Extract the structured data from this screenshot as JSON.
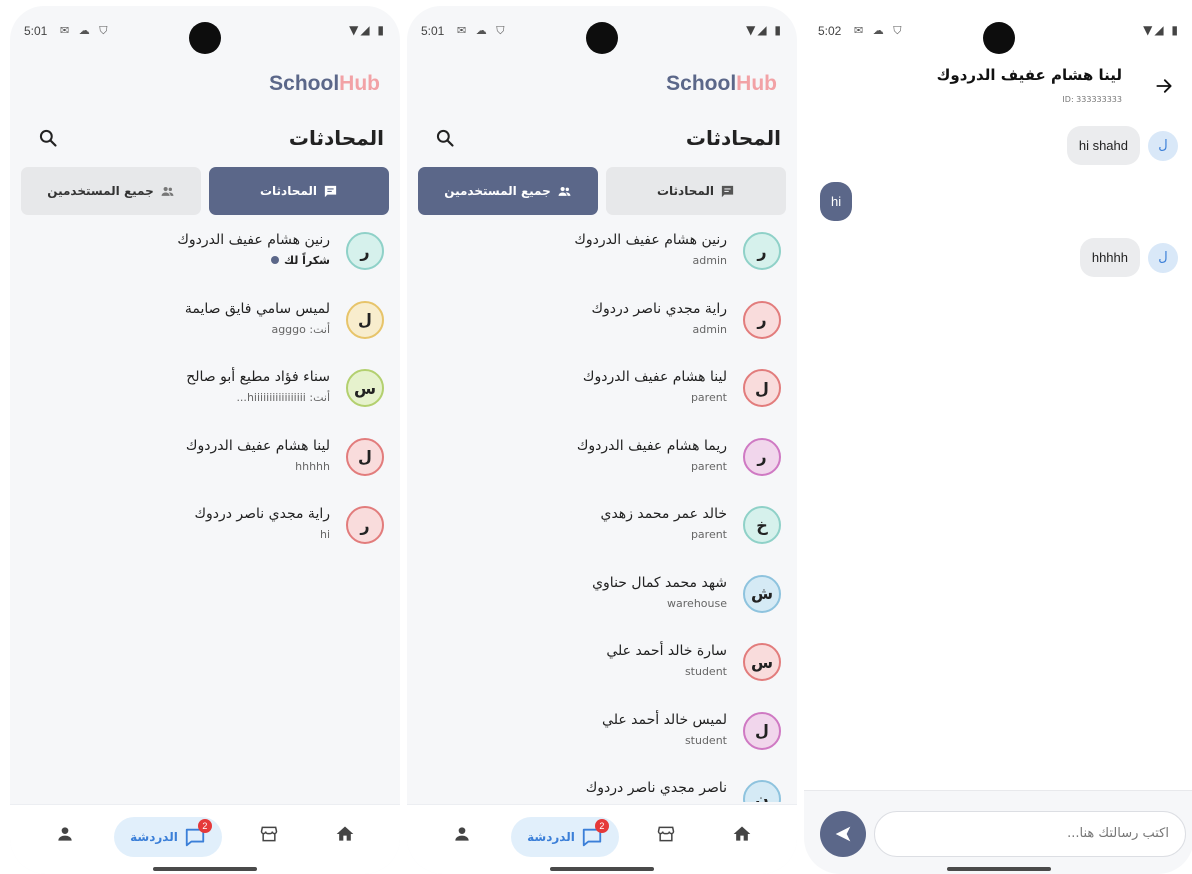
{
  "colors": {
    "primary": "#5b6789",
    "accent": "#f2a2a6",
    "chat_blue": "#3b7fd8",
    "badge_red": "#e5393a"
  },
  "screen1": {
    "status_time": "5:01",
    "logo_a": "School",
    "logo_b": "Hub",
    "title": "المحادثات",
    "tab_conversations": "المحادثات",
    "tab_all_users": "جميع المستخدمين",
    "items": [
      {
        "initial": "ر",
        "name": "رنين هشام عفيف الدردوك",
        "sub": "شكراً لك",
        "color": "#8fd1c8",
        "bg": "#d6f1ec",
        "unread": true
      },
      {
        "initial": "ل",
        "name": "لميس سامي فايق صايمة",
        "sub": "أنت: agggo",
        "color": "#e7c46a",
        "bg": "#f8edcd",
        "unread": false
      },
      {
        "initial": "س",
        "name": "سناء فؤاد مطيع أبو صالح",
        "sub": "أنت: hiiiiiiiiiiiiiiiii...",
        "color": "#b3d06f",
        "bg": "#e6f2cd",
        "unread": false
      },
      {
        "initial": "ل",
        "name": "لينا هشام عفيف الدردوك",
        "sub": "hhhhh",
        "color": "#e27c7c",
        "bg": "#f9dcdc",
        "unread": false
      },
      {
        "initial": "ر",
        "name": "راية مجدي ناصر دردوك",
        "sub": "hi",
        "color": "#e27c7c",
        "bg": "#f9dcdc",
        "unread": false
      }
    ],
    "nav_chat_label": "الدردشة",
    "badge_count": "2"
  },
  "screen2": {
    "status_time": "5:01",
    "logo_a": "School",
    "logo_b": "Hub",
    "title": "المحادثات",
    "tab_conversations": "المحادثات",
    "tab_all_users": "جميع المستخدمين",
    "items": [
      {
        "initial": "ر",
        "name": "رنين هشام عفيف الدردوك",
        "sub": "admin",
        "color": "#8fd1c8",
        "bg": "#d6f1ec"
      },
      {
        "initial": "ر",
        "name": "راية مجدي ناصر دردوك",
        "sub": "admin",
        "color": "#e27c7c",
        "bg": "#f9dcdc"
      },
      {
        "initial": "ل",
        "name": "لينا هشام عفيف الدردوك",
        "sub": "parent",
        "color": "#e27c7c",
        "bg": "#f9dcdc"
      },
      {
        "initial": "ر",
        "name": "ريما هشام عفيف الدردوك",
        "sub": "parent",
        "color": "#cf79c3",
        "bg": "#f1d6ec"
      },
      {
        "initial": "خ",
        "name": "خالد عمر محمد زهدي",
        "sub": "parent",
        "color": "#8fd1c8",
        "bg": "#d6f1ec"
      },
      {
        "initial": "ش",
        "name": "شهد محمد كمال حناوي",
        "sub": "warehouse",
        "color": "#8ec3de",
        "bg": "#d5eaf5"
      },
      {
        "initial": "س",
        "name": "سارة خالد أحمد علي",
        "sub": "student",
        "color": "#e27c7c",
        "bg": "#f9dcdc"
      },
      {
        "initial": "ل",
        "name": "لميس خالد أحمد علي",
        "sub": "student",
        "color": "#cf79c3",
        "bg": "#f1d6ec"
      },
      {
        "initial": "ن",
        "name": "ناصر مجدي ناصر دردوك",
        "sub": "",
        "color": "#8ec3de",
        "bg": "#d5eaf5"
      }
    ],
    "nav_chat_label": "الدردشة",
    "badge_count": "2"
  },
  "screen3": {
    "status_time": "5:02",
    "contact_name": "لينا هشام عفيف الدردوك",
    "contact_id": "ID: 333333333",
    "messages": [
      {
        "text": "hi shahd",
        "from": "them",
        "initial": "ل"
      },
      {
        "text": "hi",
        "from": "me"
      },
      {
        "text": "hhhhh",
        "from": "them",
        "initial": "ل"
      }
    ],
    "input_placeholder": "اكتب رسالتك هنا..."
  }
}
